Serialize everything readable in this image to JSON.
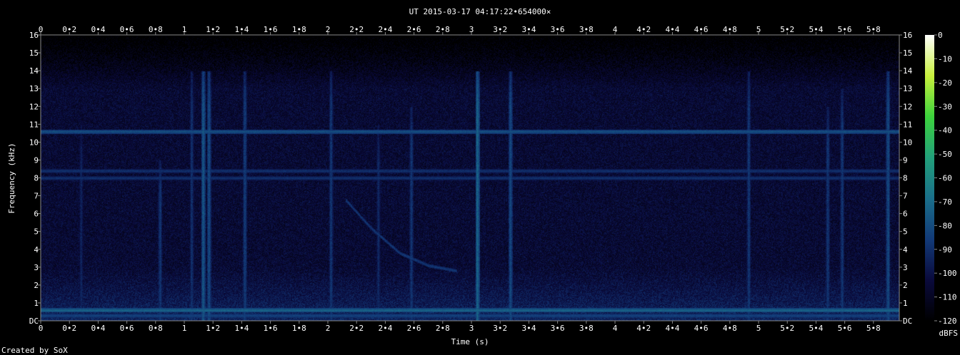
{
  "chart_data": {
    "type": "heatmap",
    "title": "UT 2015-03-17 04:17:22•654000×",
    "xlabel": "Time (s)",
    "ylabel": "Frequency (kHz)",
    "xlim": [
      0,
      5.98
    ],
    "ylim": [
      0,
      16
    ],
    "x_ticks": [
      {
        "v": 0,
        "label": "0"
      },
      {
        "v": 0.2,
        "label": "0•2"
      },
      {
        "v": 0.4,
        "label": "0•4"
      },
      {
        "v": 0.6,
        "label": "0•6"
      },
      {
        "v": 0.8,
        "label": "0•8"
      },
      {
        "v": 1,
        "label": "1"
      },
      {
        "v": 1.2,
        "label": "1•2"
      },
      {
        "v": 1.4,
        "label": "1•4"
      },
      {
        "v": 1.6,
        "label": "1•6"
      },
      {
        "v": 1.8,
        "label": "1•8"
      },
      {
        "v": 2,
        "label": "2"
      },
      {
        "v": 2.2,
        "label": "2•2"
      },
      {
        "v": 2.4,
        "label": "2•4"
      },
      {
        "v": 2.6,
        "label": "2•6"
      },
      {
        "v": 2.8,
        "label": "2•8"
      },
      {
        "v": 3,
        "label": "3"
      },
      {
        "v": 3.2,
        "label": "3•2"
      },
      {
        "v": 3.4,
        "label": "3•4"
      },
      {
        "v": 3.6,
        "label": "3•6"
      },
      {
        "v": 3.8,
        "label": "3•8"
      },
      {
        "v": 4,
        "label": "4"
      },
      {
        "v": 4.2,
        "label": "4•2"
      },
      {
        "v": 4.4,
        "label": "4•4"
      },
      {
        "v": 4.6,
        "label": "4•6"
      },
      {
        "v": 4.8,
        "label": "4•8"
      },
      {
        "v": 5,
        "label": "5"
      },
      {
        "v": 5.2,
        "label": "5•2"
      },
      {
        "v": 5.4,
        "label": "5•4"
      },
      {
        "v": 5.6,
        "label": "5•6"
      },
      {
        "v": 5.8,
        "label": "5•8"
      }
    ],
    "y_ticks": [
      {
        "v": 0,
        "label": "DC"
      },
      {
        "v": 1,
        "label": "1"
      },
      {
        "v": 2,
        "label": "2"
      },
      {
        "v": 3,
        "label": "3"
      },
      {
        "v": 4,
        "label": "4"
      },
      {
        "v": 5,
        "label": "5"
      },
      {
        "v": 6,
        "label": "6"
      },
      {
        "v": 7,
        "label": "7"
      },
      {
        "v": 8,
        "label": "8"
      },
      {
        "v": 9,
        "label": "9"
      },
      {
        "v": 10,
        "label": "10"
      },
      {
        "v": 11,
        "label": "11"
      },
      {
        "v": 12,
        "label": "12"
      },
      {
        "v": 13,
        "label": "13"
      },
      {
        "v": 14,
        "label": "14"
      },
      {
        "v": 15,
        "label": "15"
      },
      {
        "v": 16,
        "label": "16"
      }
    ],
    "colorbar": {
      "label": "dBFS",
      "range": [
        -120,
        0
      ],
      "ticks": [
        {
          "v": 0,
          "label": "0"
        },
        {
          "v": -10,
          "label": "-10"
        },
        {
          "v": -20,
          "label": "-20"
        },
        {
          "v": -30,
          "label": "-30"
        },
        {
          "v": -40,
          "label": "-40"
        },
        {
          "v": -50,
          "label": "-50"
        },
        {
          "v": -60,
          "label": "-60"
        },
        {
          "v": -70,
          "label": "-70"
        },
        {
          "v": -80,
          "label": "-80"
        },
        {
          "v": -90,
          "label": "-90"
        },
        {
          "v": -100,
          "label": "-100"
        },
        {
          "v": -110,
          "label": "-110"
        },
        {
          "v": -120,
          "label": "-120"
        }
      ],
      "colors": [
        "#000000",
        "#0a0a3c",
        "#123a78",
        "#1a6f8a",
        "#22a07a",
        "#3cd23c",
        "#c8f03c",
        "#ffffff"
      ]
    },
    "noise_floor_dbfs": -105,
    "horizontal_lines": [
      {
        "freq": 10.6,
        "level": -78
      },
      {
        "freq": 8.4,
        "level": -88
      },
      {
        "freq": 8.0,
        "level": -88
      },
      {
        "freq": 0.6,
        "level": -72
      },
      {
        "freq": 0.3,
        "level": -82
      }
    ],
    "vertical_events": [
      {
        "time": 0.28,
        "fmax": 11,
        "level": -92
      },
      {
        "time": 0.83,
        "fmax": 9,
        "level": -86
      },
      {
        "time": 1.05,
        "fmax": 14,
        "level": -88
      },
      {
        "time": 1.13,
        "fmax": 14,
        "level": -76
      },
      {
        "time": 1.17,
        "fmax": 14,
        "level": -80
      },
      {
        "time": 1.42,
        "fmax": 14,
        "level": -84
      },
      {
        "time": 2.02,
        "fmax": 14,
        "level": -86
      },
      {
        "time": 2.35,
        "fmax": 11,
        "level": -90
      },
      {
        "time": 2.58,
        "fmax": 12,
        "level": -86
      },
      {
        "time": 3.04,
        "fmax": 14,
        "level": -72
      },
      {
        "time": 3.27,
        "fmax": 14,
        "level": -80
      },
      {
        "time": 4.93,
        "fmax": 14,
        "level": -86
      },
      {
        "time": 5.48,
        "fmax": 12,
        "level": -86
      },
      {
        "time": 5.58,
        "fmax": 13,
        "level": -86
      },
      {
        "time": 5.9,
        "fmax": 14,
        "level": -80
      }
    ],
    "sweep_curve": {
      "t": [
        2.12,
        2.3,
        2.5,
        2.7,
        2.9
      ],
      "f": [
        6.8,
        5.2,
        3.8,
        3.1,
        2.8
      ],
      "level": -86
    }
  },
  "footer": {
    "created_by": "Created by SoX"
  }
}
